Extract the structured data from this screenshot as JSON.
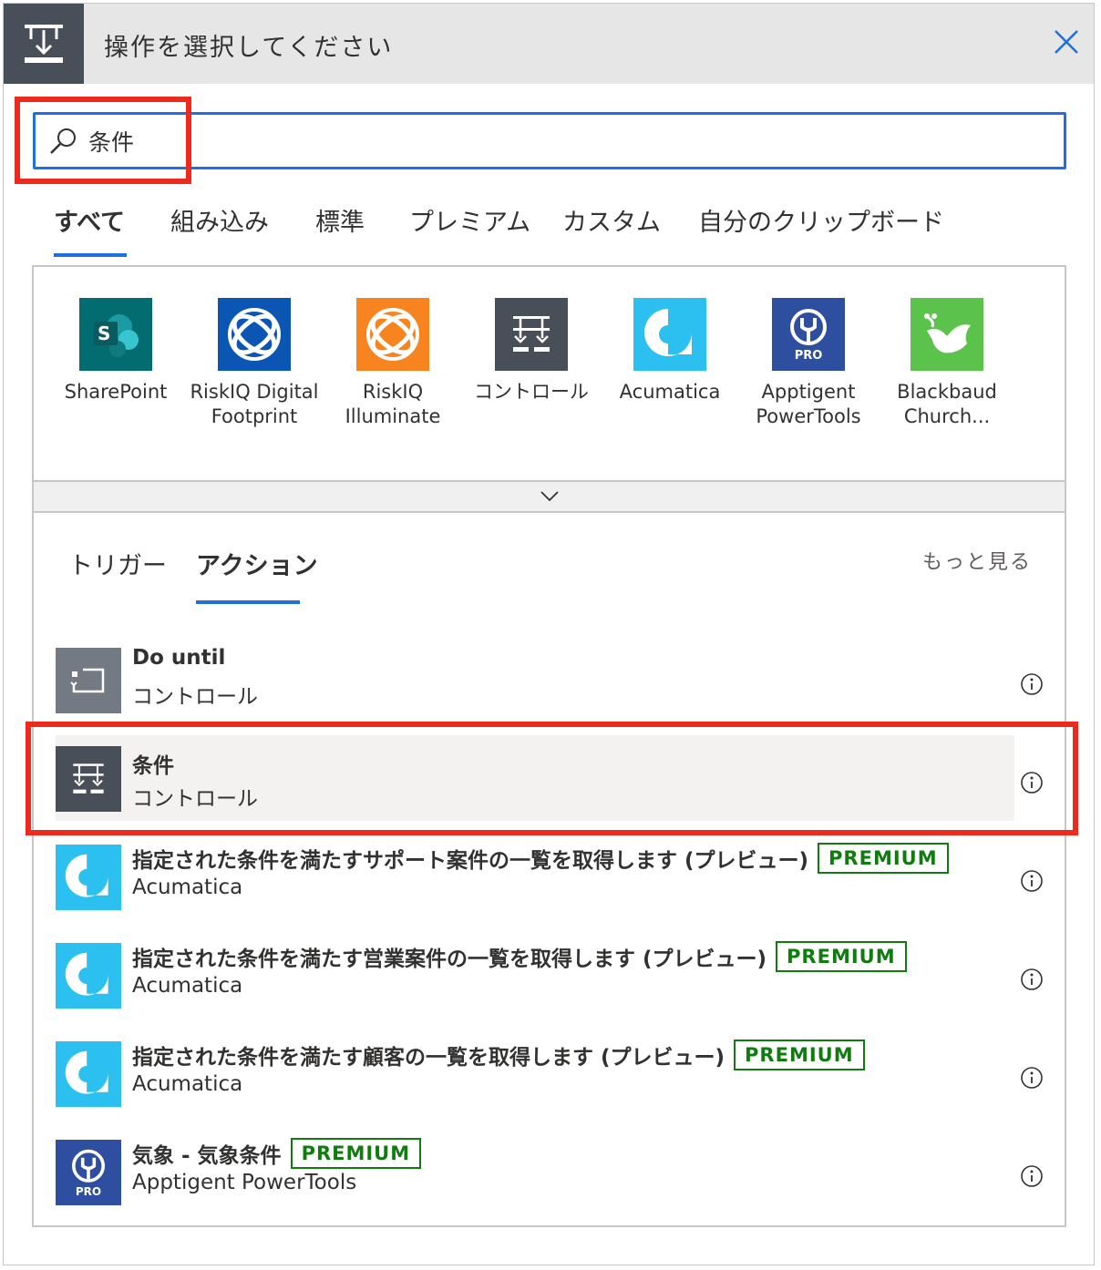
{
  "header": {
    "title": "操作を選択してください"
  },
  "search": {
    "value": "条件"
  },
  "tabs": [
    {
      "label": "すべて"
    },
    {
      "label": "組み込み"
    },
    {
      "label": "標準"
    },
    {
      "label": "プレミアム"
    },
    {
      "label": "カスタム"
    },
    {
      "label": "自分のクリップボード"
    }
  ],
  "connectors": [
    {
      "line1": "SharePoint",
      "line2": ""
    },
    {
      "line1": "RiskIQ Digital",
      "line2": "Footprint"
    },
    {
      "line1": "RiskIQ",
      "line2": "Illuminate"
    },
    {
      "line1": "コントロール",
      "line2": ""
    },
    {
      "line1": "Acumatica",
      "line2": ""
    },
    {
      "line1": "Apptigent",
      "line2": "PowerTools"
    },
    {
      "line1": "Blackbaud",
      "line2": "Church..."
    }
  ],
  "subtabs": [
    {
      "label": "トリガー"
    },
    {
      "label": "アクション"
    }
  ],
  "more_label": "もっと見る",
  "actions": [
    {
      "title": "Do until",
      "sub": "コントロール",
      "premium": ""
    },
    {
      "title": "条件",
      "sub": "コントロール",
      "premium": ""
    },
    {
      "title": "指定された条件を満たすサポート案件の一覧を取得します (プレビュー)",
      "sub": "Acumatica",
      "premium": "PREMIUM"
    },
    {
      "title": "指定された条件を満たす営業案件の一覧を取得します (プレビュー)",
      "sub": "Acumatica",
      "premium": "PREMIUM"
    },
    {
      "title": "指定された条件を満たす顧客の一覧を取得します (プレビュー)",
      "sub": "Acumatica",
      "premium": "PREMIUM"
    },
    {
      "title": "気象 - 気象条件",
      "sub": "Apptigent PowerTools",
      "premium": "PREMIUM"
    }
  ],
  "icon_labels": {
    "pro": "PRO",
    "sharepoint_letter": "S"
  },
  "colors": {
    "accent": "#1f6fde",
    "premium": "#107c10",
    "annotation": "#ee2a1e",
    "control": "#484f58",
    "acumatica": "#2bc0ef",
    "apptigent": "#2e4fa0"
  }
}
